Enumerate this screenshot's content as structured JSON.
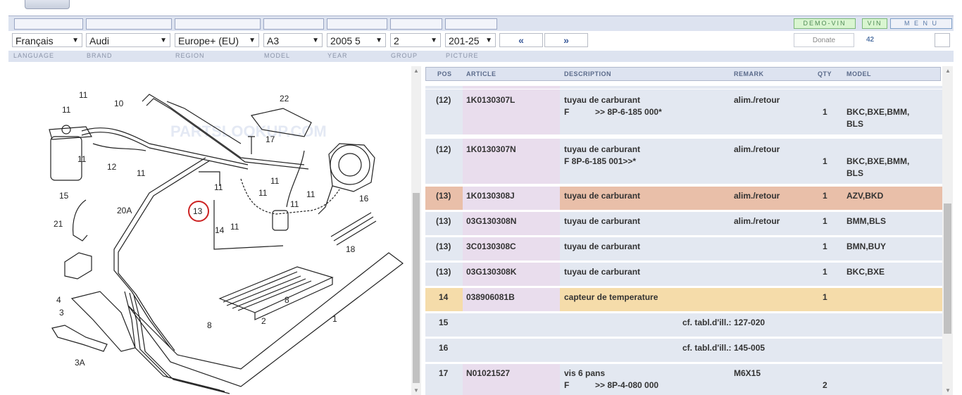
{
  "toolbar": {
    "demo_vin": "DEMO-VIN",
    "vin": "VIN",
    "menu": "M E N U"
  },
  "selectors": {
    "language": "Français",
    "brand": "Audi",
    "region": "Europe+ (EU)",
    "model": "A3",
    "year": "2005  5",
    "group": "2",
    "picture": "201-25",
    "prev": "«",
    "next": "»",
    "donate": "Donate",
    "count": "42"
  },
  "labels": {
    "language": "LANGUAGE",
    "brand": "BRAND",
    "region": "REGION",
    "model": "MODEL",
    "year": "YEAR",
    "group": "GROUP",
    "picture": "PICTURE"
  },
  "diagram": {
    "callouts": [
      "22",
      "11",
      "11",
      "10",
      "17",
      "11",
      "11",
      "11",
      "12",
      "11",
      "11",
      "15",
      "13",
      "11",
      "11",
      "16",
      "20A",
      "11",
      "14",
      "21",
      "18",
      "4",
      "3",
      "8",
      "2",
      "1",
      "8",
      "3A"
    ],
    "watermark": "PARTSLOOKUP.COM"
  },
  "table": {
    "headers": {
      "pos": "POS",
      "article": "ARTICLE",
      "description": "DESCRIPTION",
      "remark": "REMARK",
      "qty": "QTY",
      "model": "MODEL"
    },
    "rows": [
      {
        "pos": "(12)",
        "article": "1K0130307L",
        "desc1": "tuyau de carburant",
        "desc2": "F           >> 8P-6-185 000*",
        "remark": "alim./retour",
        "qty": "1",
        "model1": "BKC,BXE,BMM,",
        "model2": "BLS",
        "style": "normal"
      },
      {
        "pos": "(12)",
        "article": "1K0130307N",
        "desc1": "tuyau de carburant",
        "desc2": "F 8P-6-185 001>>*",
        "remark": "alim./retour",
        "qty": "1",
        "model1": "BKC,BXE,BMM,",
        "model2": "BLS",
        "style": "normal"
      },
      {
        "pos": "(13)",
        "article": "1K0130308J",
        "desc1": "tuyau de carburant",
        "desc2": "",
        "remark": "alim./retour",
        "qty": "1",
        "model1": "AZV,BKD",
        "model2": "",
        "style": "salmon"
      },
      {
        "pos": "(13)",
        "article": "03G130308N",
        "desc1": "tuyau de carburant",
        "desc2": "",
        "remark": "alim./retour",
        "qty": "1",
        "model1": "BMM,BLS",
        "model2": "",
        "style": "normal"
      },
      {
        "pos": "(13)",
        "article": "3C0130308C",
        "desc1": "tuyau de carburant",
        "desc2": "",
        "remark": "",
        "qty": "1",
        "model1": "BMN,BUY",
        "model2": "",
        "style": "normal"
      },
      {
        "pos": "(13)",
        "article": "03G130308K",
        "desc1": "tuyau de carburant",
        "desc2": "",
        "remark": "",
        "qty": "1",
        "model1": "BKC,BXE",
        "model2": "",
        "style": "normal"
      },
      {
        "pos": "14",
        "article": "038906081B",
        "desc1": "capteur de temperature",
        "desc2": "",
        "remark": "",
        "qty": "1",
        "model1": "",
        "model2": "",
        "style": "yellow"
      },
      {
        "pos": "15",
        "article": "",
        "desc1": "",
        "desc2": "",
        "ref_label": "cf. tabl.d'ill.:",
        "remark": "127-020",
        "qty": "",
        "model1": "",
        "model2": "",
        "style": "normal"
      },
      {
        "pos": "16",
        "article": "",
        "desc1": "",
        "desc2": "",
        "ref_label": "cf. tabl.d'ill.:",
        "remark": "145-005",
        "qty": "",
        "model1": "",
        "model2": "",
        "style": "normal"
      },
      {
        "pos": "17",
        "article": "N01021527",
        "desc1": "vis 6 pans",
        "desc2": "F           >> 8P-4-080 000",
        "remark": "M6X15",
        "qty": "2",
        "model1": "",
        "model2": "",
        "style": "normal"
      }
    ]
  },
  "colors": {
    "header_bg": "#dde3f0",
    "row_bg": "#e3e8f1",
    "article_bg": "#e9dded",
    "highlight_salmon": "#e9bfa9",
    "highlight_yellow": "#f5dcaa",
    "callout_ring": "#cc2222"
  }
}
